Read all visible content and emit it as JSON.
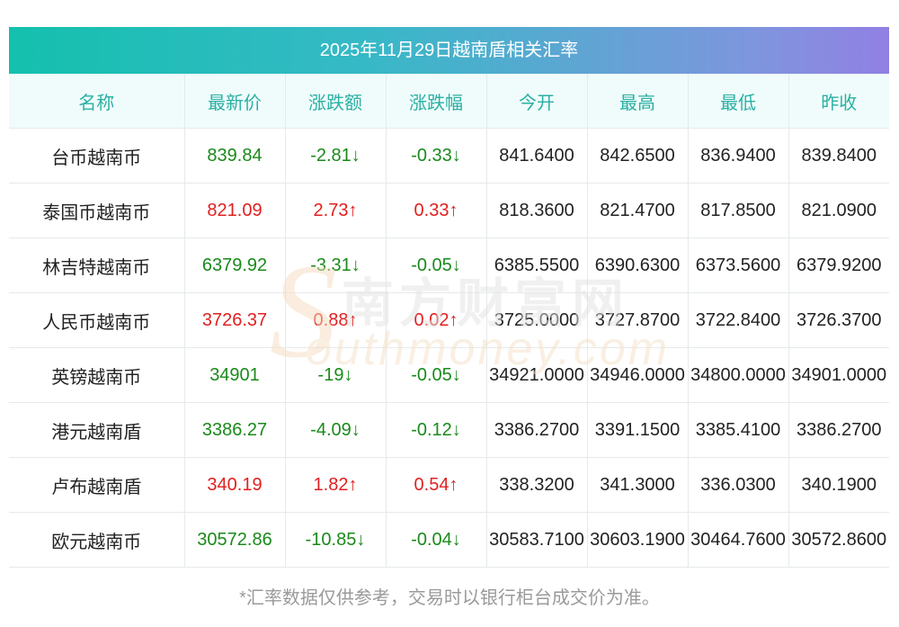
{
  "title": "2025年11月29日越南盾相关汇率",
  "headers": [
    "名称",
    "最新价",
    "涨跌额",
    "涨跌幅",
    "今开",
    "最高",
    "最低",
    "昨收"
  ],
  "rows": [
    {
      "name": "台币越南币",
      "last": "839.84",
      "change": "-2.81↓",
      "pct": "-0.33↓",
      "open": "841.6400",
      "high": "842.6500",
      "low": "836.9400",
      "prev": "839.8400",
      "dir": "down"
    },
    {
      "name": "泰国币越南币",
      "last": "821.09",
      "change": "2.73↑",
      "pct": "0.33↑",
      "open": "818.3600",
      "high": "821.4700",
      "low": "817.8500",
      "prev": "821.0900",
      "dir": "up"
    },
    {
      "name": "林吉特越南币",
      "last": "6379.92",
      "change": "-3.31↓",
      "pct": "-0.05↓",
      "open": "6385.5500",
      "high": "6390.6300",
      "low": "6373.5600",
      "prev": "6379.9200",
      "dir": "down"
    },
    {
      "name": "人民币越南币",
      "last": "3726.37",
      "change": "0.88↑",
      "pct": "0.02↑",
      "open": "3725.0000",
      "high": "3727.8700",
      "low": "3722.8400",
      "prev": "3726.3700",
      "dir": "up"
    },
    {
      "name": "英镑越南币",
      "last": "34901",
      "change": "-19↓",
      "pct": "-0.05↓",
      "open": "34921.0000",
      "high": "34946.0000",
      "low": "34800.0000",
      "prev": "34901.0000",
      "dir": "down"
    },
    {
      "name": "港元越南盾",
      "last": "3386.27",
      "change": "-4.09↓",
      "pct": "-0.12↓",
      "open": "3386.2700",
      "high": "3391.1500",
      "low": "3385.4100",
      "prev": "3386.2700",
      "dir": "down"
    },
    {
      "name": "卢布越南盾",
      "last": "340.19",
      "change": "1.82↑",
      "pct": "0.54↑",
      "open": "338.3200",
      "high": "341.3000",
      "low": "336.0300",
      "prev": "340.1900",
      "dir": "up"
    },
    {
      "name": "欧元越南币",
      "last": "30572.86",
      "change": "-10.85↓",
      "pct": "-0.04↓",
      "open": "30583.7100",
      "high": "30603.1900",
      "low": "30464.7600",
      "prev": "30572.8600",
      "dir": "down"
    }
  ],
  "watermark": {
    "cn": "南方财富网",
    "en": "outhmoney.com",
    "s": "S"
  },
  "footnote": "*汇率数据仅供参考，交易时以银行柜台成交价为准。",
  "colors": {
    "up": "#e02020",
    "down": "#1a8a1a",
    "header_text": "#2ab0a4",
    "title_start": "#14c0ae",
    "title_end": "#9180e3"
  }
}
